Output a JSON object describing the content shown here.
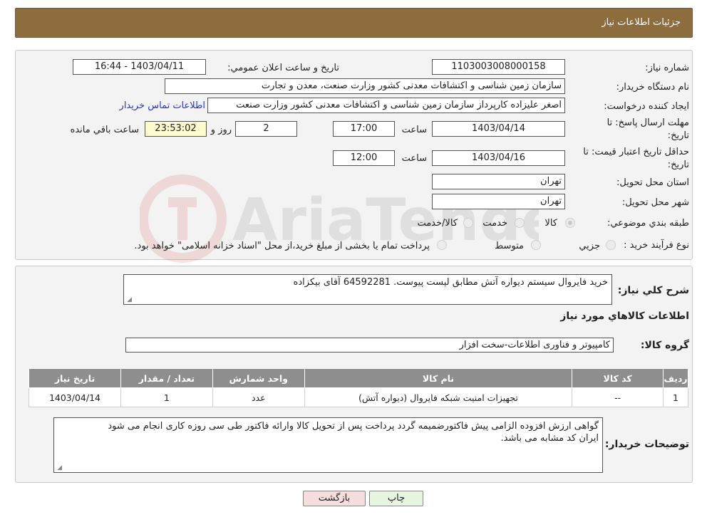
{
  "title": "جزئيات اطلاعات نياز",
  "need_number": {
    "label": "شماره نياز:",
    "value": "1103003008000158"
  },
  "announce": {
    "label": "تاريخ و ساعت اعلان عمومي:",
    "value": "1403/04/11 - 16:44"
  },
  "buyer_org": {
    "label": "نام دستگاه خريدار:",
    "value": "سازمان زمین شناسی و اکتشافات معدنی کشور وزارت صنعت، معدن و تجارت"
  },
  "creator": {
    "label": "ايجاد کننده درخواست:",
    "value": "اصغر علیزاده کارپرداز سازمان زمین شناسی و اکتشافات معدنی کشور وزارت صنعت",
    "contact_link": "اطلاعات تماس خريدار"
  },
  "reply_deadline": {
    "label_line1": "مهلت ارسال پاسخ: تا",
    "label_line2": "تاريخ:",
    "date": "1403/04/14",
    "time_label": "ساعت",
    "time": "17:00",
    "days": "2",
    "days_label": "روز و",
    "remaining": "23:53:02",
    "remaining_label": "ساعت باقي مانده"
  },
  "price_validity": {
    "label_line1": "حداقل تاريخ اعتبار قيمت: تا",
    "label_line2": "تاريخ:",
    "date": "1403/04/16",
    "time_label": "ساعت",
    "time": "12:00"
  },
  "province": {
    "label": "استان محل تحويل:",
    "value": "تهران"
  },
  "city": {
    "label": "شهر محل تحويل:",
    "value": "تهران"
  },
  "category": {
    "label": "طبقه بندي موضوعي:",
    "options": [
      "کالا",
      "خدمت",
      "کالا/خدمت"
    ],
    "selected": "کالا"
  },
  "process": {
    "label": "نوع فرآيند خريد :",
    "options": [
      "جزيي",
      "متوسط"
    ],
    "note": "پرداخت تمام يا بخشی از مبلغ خريد،از محل \"اسناد خزانه اسلامی\" خواهد بود."
  },
  "description": {
    "label": "شرح کلي نياز:",
    "value": "خرید فایروال سیستم دیواره آتش مطابق لیست پیوست.  64592281 آقای بیکزاده"
  },
  "goods_info_title": "اطلاعات کالاهاي مورد نياز",
  "goods_group": {
    "label": "گروه کالا:",
    "value": "کامپیوتر و فناوری اطلاعات-سخت افزار"
  },
  "table": {
    "headers": [
      "رديف",
      "کد کالا",
      "نام کالا",
      "واحد شمارش",
      "تعداد / مقدار",
      "تاريخ نياز"
    ],
    "rows": [
      [
        "1",
        "--",
        "تجهیزات امنیت شبکه فایروال (دیواره آتش)",
        "عدد",
        "1",
        "1403/04/14"
      ]
    ]
  },
  "buyer_notes": {
    "label": "توضيحات خريدار:",
    "line1": "گواهی ارزش افزوده الزامی پیش فاکتورضمیمه گردد پرداخت پس از تحویل کالا وارائه فاکتور طی سی روزه کاری انجام می شود",
    "line2": "ایران کد مشابه می باشد."
  },
  "buttons": {
    "print": "چاپ",
    "back": "بازگشت"
  },
  "watermark": "AriaTender.neT",
  "colors": {
    "titlebar": "#8d6c3e",
    "link": "#2a36c8",
    "back_button": "#f7dede",
    "print_button": "#e6f5e0"
  }
}
